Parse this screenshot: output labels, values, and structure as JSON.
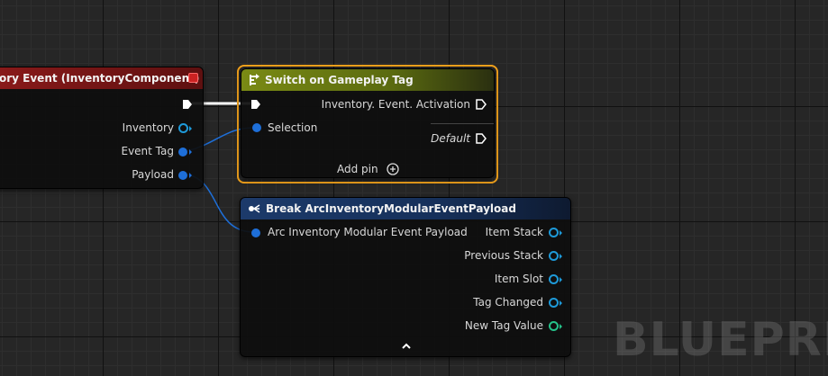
{
  "event_node": {
    "title": "ory Event (InventoryComponent)",
    "pins": {
      "inventory": "Inventory",
      "event_tag": "Event Tag",
      "payload": "Payload"
    }
  },
  "switch_node": {
    "title": "Switch on Gameplay Tag",
    "selection": "Selection",
    "case_activation": "Inventory. Event. Activation",
    "default": "Default",
    "add_pin": "Add pin",
    "add_pin_icon": "plus-circle-icon"
  },
  "break_node": {
    "title": "Break ArcInventoryModularEventPayload",
    "input": "Arc Inventory Modular Event Payload",
    "outputs": {
      "item_stack": "Item Stack",
      "previous_stack": "Previous Stack",
      "item_slot": "Item Slot",
      "tag_changed": "Tag Changed",
      "new_tag_value": "New Tag Value"
    },
    "collapse_icon": "chevron-up-icon"
  },
  "watermark": "BLUEPRINT",
  "colors": {
    "event_header": "#8a1a1a",
    "switch_header": "#7a8a14",
    "break_header": "#1c3a6a",
    "selection_border": "#f2a21c",
    "struct_pin": "#1e6fd9",
    "object_pin": "#1e9ad9",
    "bool_pin_green": "#25c28a"
  }
}
